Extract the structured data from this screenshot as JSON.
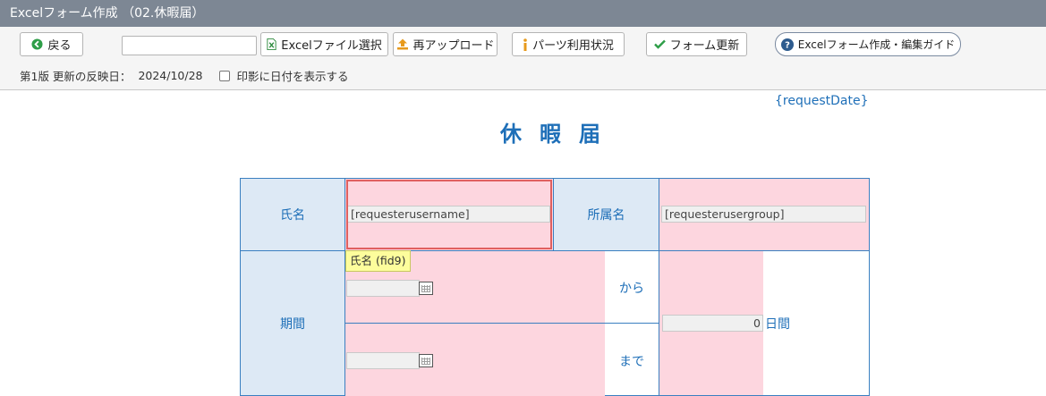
{
  "window": {
    "title": "Excelフォーム作成 （02.休暇届）"
  },
  "toolbar": {
    "back_label": "戻る",
    "search_value": "",
    "excel_select_label": "Excelファイル選択",
    "reupload_label": "再アップロード",
    "parts_usage_label": "パーツ利用状況",
    "form_update_label": "フォーム更新",
    "guide_label": "Excelフォーム作成・編集ガイド"
  },
  "meta": {
    "version_text": "第1版 更新の反映日：",
    "date": "2024/10/28",
    "stamp_date_label": "印影に日付を表示する",
    "stamp_date_checked": false
  },
  "form": {
    "request_date": "{requestDate}",
    "title": "休暇届",
    "name_label": "氏名",
    "name_field": "[requesterusername]",
    "group_label": "所属名",
    "group_field": "[requesterusergroup]",
    "period_label": "期間",
    "from_text": "から",
    "to_text": "まで",
    "days_value": "0",
    "days_unit": "日間",
    "start_date_value": "",
    "end_date_value": ""
  },
  "tooltip": {
    "text": "氏名 (fid9)"
  },
  "colors": {
    "accent": "#1e6fb8",
    "label_bg": "#dde9f5",
    "field_pink": "#fdd6df",
    "titlebar": "#7d8794",
    "selection": "#e06060"
  },
  "icons": {
    "back": "arrow-left-circle-icon",
    "excel": "excel-file-icon",
    "upload": "upload-icon",
    "info": "info-icon",
    "check": "check-icon",
    "help": "question-circle-icon",
    "calendar": "calendar-icon"
  }
}
